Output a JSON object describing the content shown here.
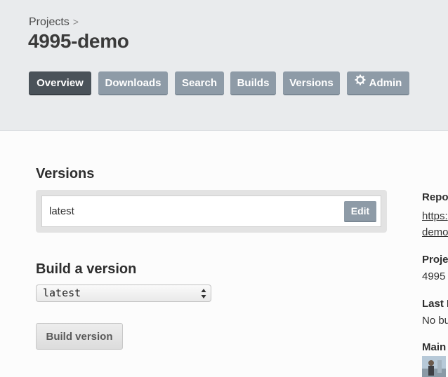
{
  "breadcrumb": {
    "parent": "Projects",
    "separator": ">"
  },
  "project": {
    "title": "4995-demo"
  },
  "tabs": [
    {
      "label": "Overview",
      "active": true
    },
    {
      "label": "Downloads",
      "active": false
    },
    {
      "label": "Search",
      "active": false
    },
    {
      "label": "Builds",
      "active": false
    },
    {
      "label": "Versions",
      "active": false
    },
    {
      "label": "Admin",
      "active": false,
      "icon": "gear-icon"
    }
  ],
  "versions": {
    "title": "Versions",
    "items": [
      {
        "name": "latest",
        "edit_label": "Edit"
      }
    ]
  },
  "build": {
    "title": "Build a version",
    "selected": "latest",
    "button_label": "Build version"
  },
  "sidebar": {
    "repo_label": "Repo",
    "repo_link_line1": "https:",
    "repo_link_line2": "demo",
    "project_label": "Proje",
    "project_value": "4995",
    "last_build_label": "Last B",
    "last_build_value": "No bu",
    "maintainers_label": "Main"
  },
  "colors": {
    "header_bg": "#e9ebed",
    "tab_active": "#4a5259",
    "tab_default": "#8e9ba7"
  }
}
